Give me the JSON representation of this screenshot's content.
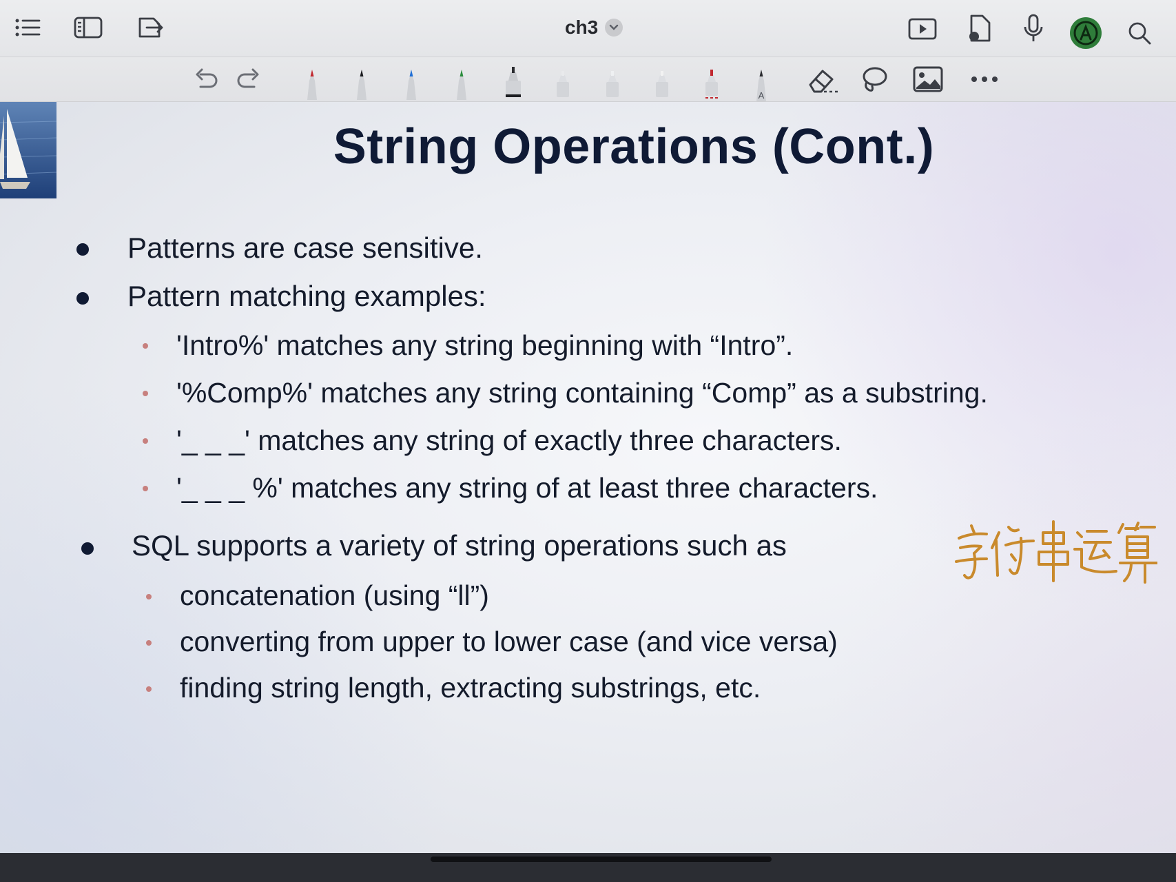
{
  "topbar": {
    "doc_title": "ch3",
    "left_icons": [
      "list-icon",
      "sidebar-icon",
      "export-icon"
    ],
    "right_icons": [
      "present-icon",
      "document-audio-icon",
      "microphone-icon",
      "pencil-mode-icon",
      "search-icon"
    ],
    "accent_color": "#2f7d3a"
  },
  "toolbar": {
    "tools": [
      "undo-icon",
      "redo-icon",
      "pen-red-icon",
      "pen-black-icon",
      "pen-blue-icon",
      "pen-green-icon",
      "marker-black-icon",
      "highlighter-white-icon",
      "highlighter-white-icon",
      "highlighter-white-icon",
      "marker-red-dashed-icon",
      "text-pen-icon",
      "eraser-icon",
      "lasso-icon",
      "image-icon",
      "more-icon"
    ],
    "text_pen_letter": "A"
  },
  "slide": {
    "title": "String Operations (Cont.)",
    "bullets": [
      {
        "text": "Patterns are case sensitive.",
        "subs": []
      },
      {
        "text": "Pattern matching examples:",
        "subs": [
          "'Intro%' matches any string beginning with “Intro”.",
          "'%Comp%' matches any string containing “Comp” as a substring.",
          "'_ _ _' matches any string of exactly three characters.",
          "'_ _ _ %' matches any string of at least three characters."
        ]
      },
      {
        "text": "SQL supports a variety of string operations such as",
        "subs": [
          "concatenation (using “ll”)",
          "converting from upper to lower case (and vice versa)",
          "finding string length, extracting substrings, etc."
        ]
      }
    ],
    "handwritten_note": "字符串运算",
    "ink_color": "#c98a2c"
  }
}
